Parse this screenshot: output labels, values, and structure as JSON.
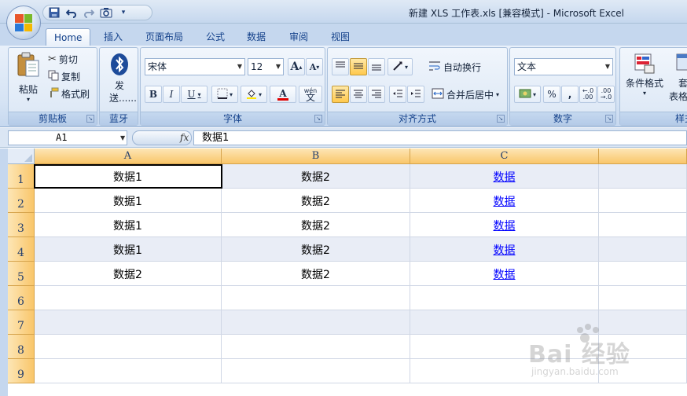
{
  "window": {
    "title": "新建 XLS 工作表.xls  [兼容模式] - Microsoft Excel"
  },
  "qat": {
    "icons": [
      "save-icon",
      "undo-icon",
      "redo-icon",
      "camera-icon",
      "customize-icon"
    ]
  },
  "tabs": [
    {
      "label": "Home",
      "active": true
    },
    {
      "label": "插入"
    },
    {
      "label": "页面布局"
    },
    {
      "label": "公式"
    },
    {
      "label": "数据"
    },
    {
      "label": "审阅"
    },
    {
      "label": "视图"
    }
  ],
  "ribbon": {
    "clipboard": {
      "label": "剪贴板",
      "paste": "粘贴",
      "cut": "剪切",
      "copy": "复制",
      "format_painter": "格式刷"
    },
    "bluetooth": {
      "label": "蓝牙",
      "send": "发送......"
    },
    "font": {
      "label": "字体",
      "font_name": "宋体",
      "font_size": "12",
      "grow": "A",
      "shrink": "A",
      "bold": "B",
      "italic": "I",
      "underline": "U",
      "font_color_letter": "A",
      "wen": "wén",
      "wen_char": "文"
    },
    "alignment": {
      "label": "对齐方式",
      "wrap_text": "自动换行",
      "merge_center": "合并后居中"
    },
    "number": {
      "label": "数字",
      "format": "文本",
      "percent": "%",
      "comma": ",",
      "inc_decimal": "+.0\n.00",
      "dec_decimal": ".00\n→.0"
    },
    "styles": {
      "label": "样式",
      "conditional": "条件格式",
      "table_format_top": "套",
      "table_format": "表格格"
    }
  },
  "formula_bar": {
    "name_box": "A1",
    "fx": "fx",
    "value": "数据1"
  },
  "grid": {
    "columns": [
      "A",
      "B",
      "C"
    ],
    "rows": [
      {
        "num": "1",
        "cells": [
          "数据1",
          "数据2",
          "数据"
        ]
      },
      {
        "num": "2",
        "cells": [
          "数据1",
          "数据2",
          "数据"
        ]
      },
      {
        "num": "3",
        "cells": [
          "数据1",
          "数据2",
          "数据"
        ]
      },
      {
        "num": "4",
        "cells": [
          "数据1",
          "数据2",
          "数据"
        ]
      },
      {
        "num": "5",
        "cells": [
          "数据2",
          "数据2",
          "数据"
        ]
      },
      {
        "num": "6",
        "cells": [
          "",
          "",
          ""
        ]
      },
      {
        "num": "7",
        "cells": [
          "",
          "",
          ""
        ]
      },
      {
        "num": "8",
        "cells": [
          "",
          "",
          ""
        ]
      },
      {
        "num": "9",
        "cells": [
          "",
          "",
          ""
        ]
      }
    ],
    "selected_cell": "A1"
  },
  "watermark": {
    "text": "Bai 经验",
    "sub": "jingyan.baidu.com"
  },
  "colors": {
    "col_header": "#f9c66a",
    "link": "#0000ff",
    "shade": "#e9edf6"
  }
}
